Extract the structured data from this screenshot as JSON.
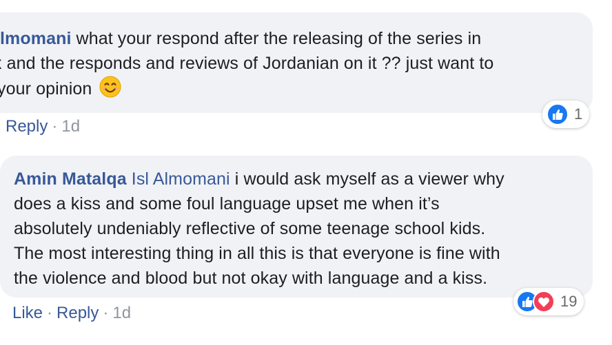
{
  "comment1": {
    "lines": [
      "lmomani what your respond after the releasing of the series in",
      "x and the responds and reviews of Jordanian on it ?? just want to",
      "your opinion"
    ],
    "emoji": "smiling-face-emoji",
    "reactions": {
      "count": "1",
      "types": [
        "like"
      ]
    },
    "actions": {
      "reply": "Reply",
      "time": "1d"
    }
  },
  "comment2": {
    "author": "Amin Matalqa",
    "mention": "Isl Almomani",
    "lines": [
      "i would ask myself as a viewer why",
      "does a kiss and some foul language upset me when it’s",
      "absolutely undeniably reflective of some teenage school kids.",
      "The most interesting thing in all this is that everyone is fine with",
      "the violence and blood but not okay with language and a kiss."
    ],
    "reactions": {
      "count": "19",
      "types": [
        "like",
        "love"
      ]
    },
    "actions": {
      "like": "Like",
      "reply": "Reply",
      "time": "1d"
    }
  },
  "colors": {
    "link": "#385898",
    "bubble": "#f0f2f5",
    "meta": "#90949c",
    "like": "#1877f2",
    "love": "#f33e58"
  }
}
